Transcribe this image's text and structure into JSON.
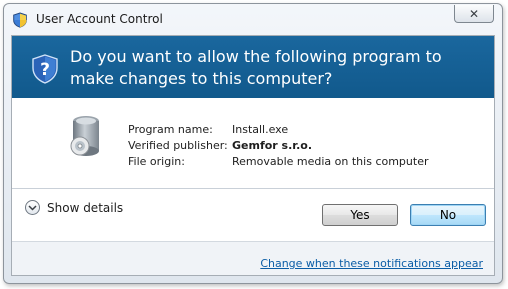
{
  "window": {
    "title": "User Account Control",
    "close_glyph": "✕"
  },
  "banner": {
    "question": "Do you want to allow the following program to make changes to this computer?"
  },
  "program": {
    "rows": [
      {
        "label": "Program name:",
        "value": "Install.exe"
      },
      {
        "label": "Verified publisher:",
        "value": "Gemfor s.r.o."
      },
      {
        "label": "File origin:",
        "value": "Removable media on this computer"
      }
    ]
  },
  "details": {
    "label": "Show details"
  },
  "buttons": {
    "yes": "Yes",
    "no": "No"
  },
  "footer": {
    "link": "Change when these notifications appear"
  },
  "icons": {
    "title": "uac-shield-icon",
    "banner": "uac-question-shield-icon",
    "program": "installer-program-icon",
    "details": "chevron-down-icon",
    "close": "close-icon"
  },
  "colors": {
    "banner": "#1a679e",
    "link": "#0b5da6",
    "default_button_border": "#3c7fb1"
  }
}
